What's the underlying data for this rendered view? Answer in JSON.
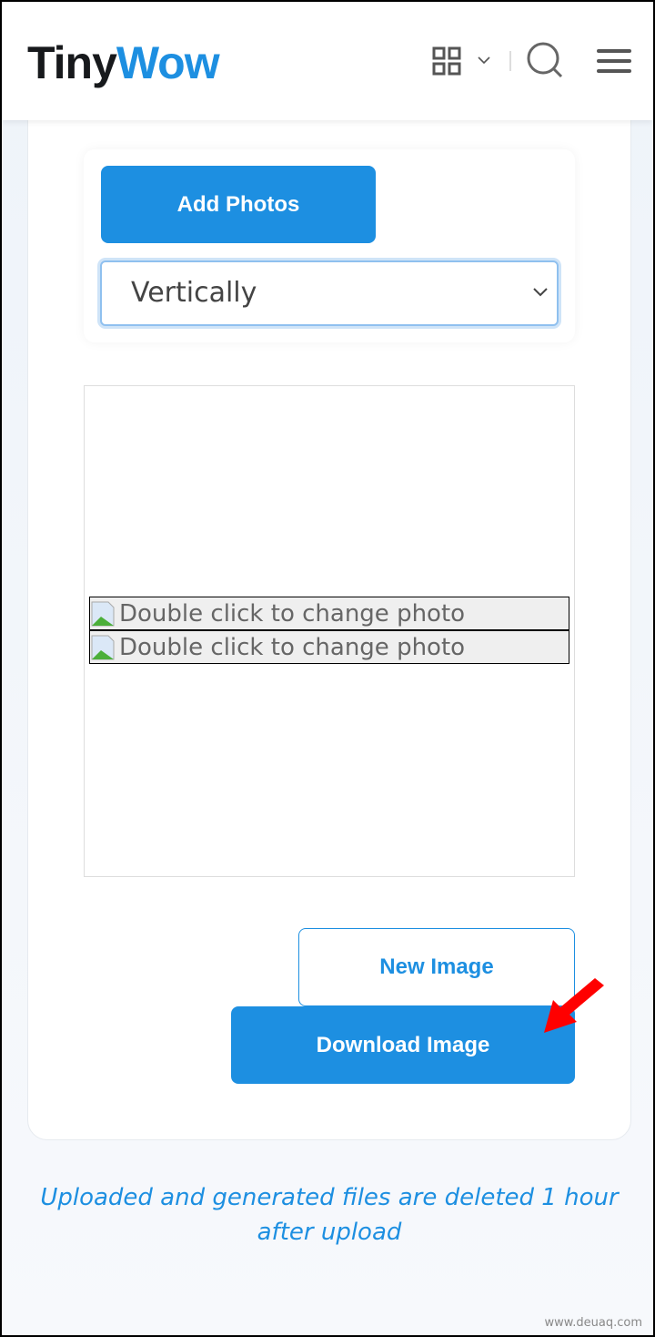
{
  "header": {
    "logo_part1": "Tiny",
    "logo_part2": "Wow",
    "icons": [
      "grid-icon",
      "chevron-down-icon",
      "search-icon",
      "menu-icon"
    ]
  },
  "tool": {
    "add_photos_label": "Add Photos",
    "direction_selected": "Vertically"
  },
  "canvas": {
    "photos": [
      {
        "alt": "Double click to change photo"
      },
      {
        "alt": "Double click to change photo"
      }
    ]
  },
  "actions": {
    "new_image_label": "New Image",
    "download_image_label": "Download Image"
  },
  "footer_note": "Uploaded and generated files are deleted 1 hour after upload",
  "watermark": "www.deuaq.com",
  "colors": {
    "accent": "#1d8fe1",
    "arrow": "#ff0000"
  }
}
